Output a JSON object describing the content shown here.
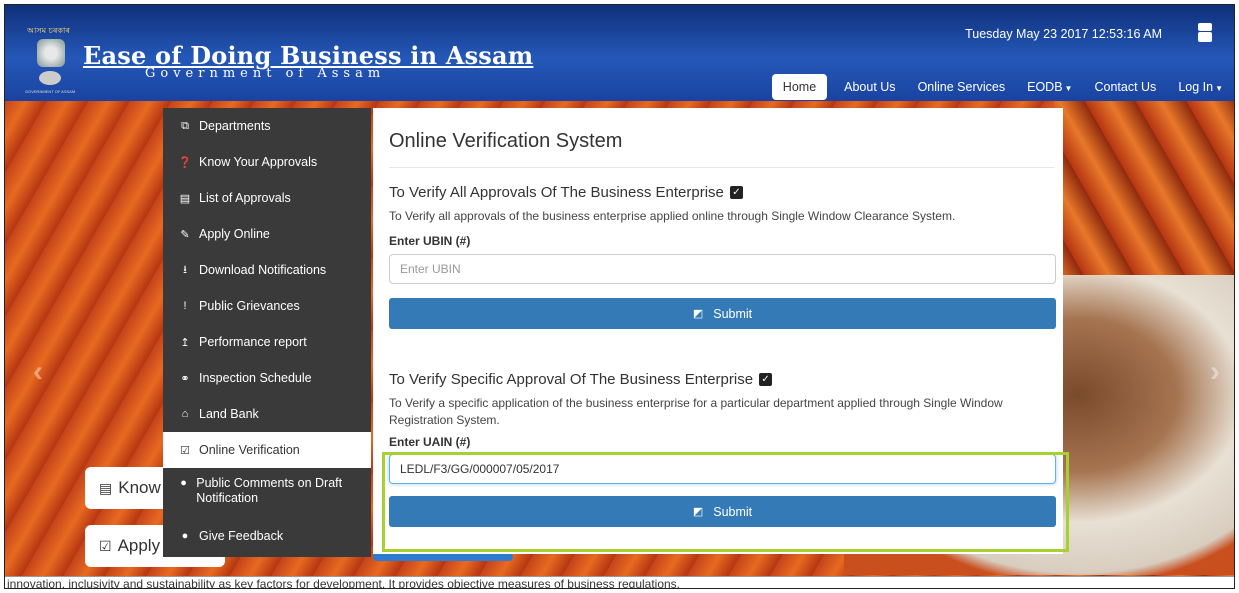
{
  "header": {
    "emblem_top_text": "আসম চৰকাৰ",
    "emblem_bottom_text": "GOVERNMENT OF ASSAM",
    "title": "Ease of Doing Business in Assam",
    "subtitle": "Government of Assam",
    "datetime": "Tuesday May 23 2017 12:53:16 AM",
    "icon": "youtube-icon"
  },
  "nav": {
    "items": [
      {
        "label": "Home",
        "active": true
      },
      {
        "label": "About Us"
      },
      {
        "label": "Online Services"
      },
      {
        "label": "EODB",
        "dropdown": true
      },
      {
        "label": "Contact Us"
      },
      {
        "label": "Log In",
        "dropdown": true
      }
    ]
  },
  "sidebar": {
    "items": [
      {
        "label": "Departments",
        "icon": "departments-icon"
      },
      {
        "label": "Know Your Approvals",
        "icon": "question-icon"
      },
      {
        "label": "List of Approvals",
        "icon": "list-icon"
      },
      {
        "label": "Apply Online",
        "icon": "edit-icon"
      },
      {
        "label": "Download Notifications",
        "icon": "download-icon"
      },
      {
        "label": "Public Grievances",
        "icon": "exclamation-icon"
      },
      {
        "label": "Performance report",
        "icon": "upload-icon"
      },
      {
        "label": "Inspection Schedule",
        "icon": "binoculars-icon"
      },
      {
        "label": "Land Bank",
        "icon": "bank-icon"
      },
      {
        "label": "Online Verification",
        "icon": "checkbox-icon",
        "active": true
      },
      {
        "label": "Public Comments on Draft Notification",
        "icon": "comment-icon"
      },
      {
        "label": "Give Feedback",
        "icon": "comment-icon"
      }
    ]
  },
  "main": {
    "title": "Online Verification System",
    "section1": {
      "title": "To Verify All Approvals Of The Business Enterprise",
      "description": "To Verify all approvals of the business enterprise applied online through Single Window Clearance System.",
      "field_label": "Enter UBIN (#)",
      "placeholder": "Enter UBIN",
      "value": "",
      "submit_label": "Submit"
    },
    "section2": {
      "title": "To Verify Specific Approval Of The Business Enterprise",
      "description": "To Verify a specific application of the business enterprise for a particular department applied through Single Window Registration System.",
      "field_label": "Enter UAIN (#)",
      "placeholder": "",
      "value": "LEDL/F3/GG/000007/05/2017",
      "submit_label": "Submit"
    }
  },
  "background": {
    "button1": "Know",
    "button2": "Apply",
    "ticker": "innovation, inclusivity and sustainability as key factors for development. It provides objective measures of business regulations."
  }
}
